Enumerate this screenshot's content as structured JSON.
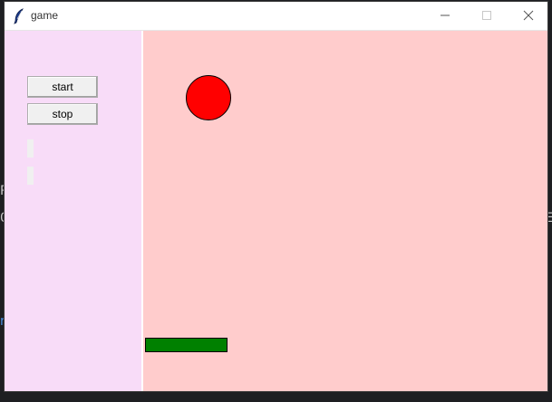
{
  "window": {
    "title": "game",
    "app_icon": "feather-icon",
    "controls": {
      "minimize_icon": "minimize-icon",
      "maximize_icon": "maximize-icon",
      "close_icon": "close-icon"
    }
  },
  "side_panel": {
    "background": "#f8dcf8",
    "buttons": {
      "start_label": "start",
      "stop_label": "stop"
    },
    "labels": [
      "",
      ""
    ]
  },
  "canvas": {
    "background": "#ffcccc",
    "ball": {
      "shape": "circle",
      "color": "#ff0000"
    },
    "paddle": {
      "shape": "rectangle",
      "color": "#008000"
    }
  }
}
